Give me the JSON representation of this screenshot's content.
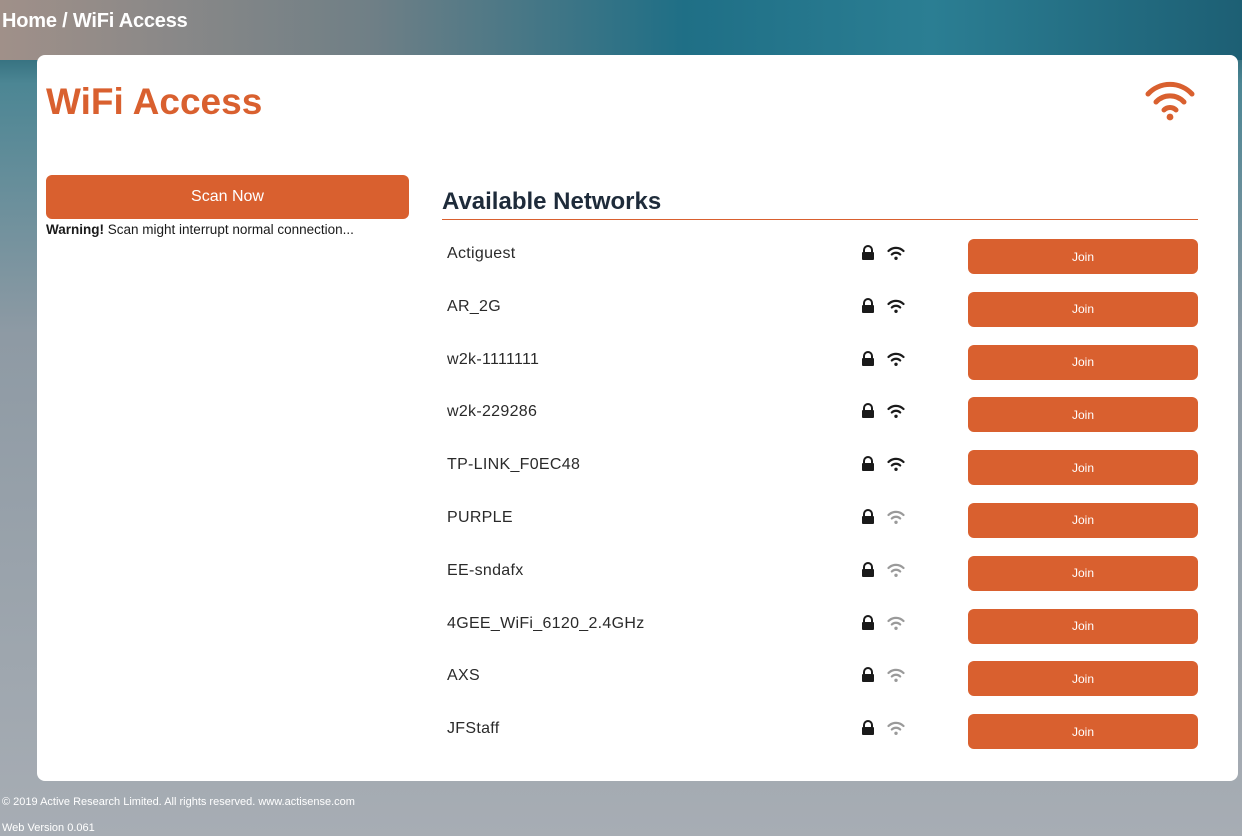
{
  "breadcrumb": {
    "home": "Home",
    "separator": "/",
    "current": "WiFi Access"
  },
  "page": {
    "title": "WiFi Access",
    "logo_icon": "wifi-icon"
  },
  "scan": {
    "button_label": "Scan Now",
    "warning_strong": "Warning!",
    "warning_text": "Scan might interrupt normal connection..."
  },
  "networks": {
    "title": "Available Networks",
    "join_label": "Join",
    "items": [
      {
        "ssid": "Actiguest",
        "secured": true,
        "signal": "strong"
      },
      {
        "ssid": "AR_2G",
        "secured": true,
        "signal": "strong"
      },
      {
        "ssid": "w2k-1111111",
        "secured": true,
        "signal": "strong"
      },
      {
        "ssid": "w2k-229286",
        "secured": true,
        "signal": "strong"
      },
      {
        "ssid": "TP-LINK_F0EC48",
        "secured": true,
        "signal": "strong"
      },
      {
        "ssid": "PURPLE",
        "secured": true,
        "signal": "weak"
      },
      {
        "ssid": "EE-sndafx",
        "secured": true,
        "signal": "weak"
      },
      {
        "ssid": "4GEE_WiFi_6120_2.4GHz",
        "secured": true,
        "signal": "weak"
      },
      {
        "ssid": "AXS",
        "secured": true,
        "signal": "weak"
      },
      {
        "ssid": "JFStaff",
        "secured": true,
        "signal": "weak"
      }
    ]
  },
  "footer": {
    "copyright": "© 2019 Active Research Limited. All rights reserved.  www.actisense.com",
    "version": "Web Version 0.061"
  },
  "colors": {
    "accent": "#d9602f",
    "heading_dark": "#1e2b3a",
    "signal_strong": "#1a1a1a",
    "signal_weak": "#9a9a9a"
  }
}
